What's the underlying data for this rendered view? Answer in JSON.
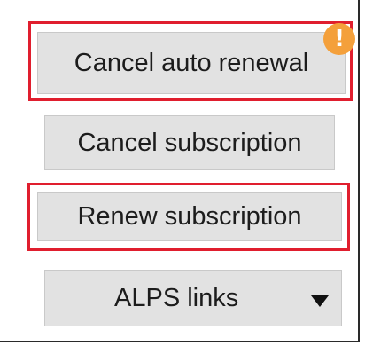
{
  "buttons": {
    "cancel_auto_renewal": "Cancel auto renewal",
    "cancel_subscription": "Cancel subscription",
    "renew_subscription": "Renew subscription",
    "alps_links": "ALPS links"
  },
  "badge": {
    "symbol": "!",
    "color": "#f4a03b"
  },
  "colors": {
    "button_bg": "#e2e2e2",
    "highlight": "#e01e2e"
  },
  "icons": {
    "alert": "warning-badge-icon",
    "dropdown": "caret-down-icon"
  }
}
